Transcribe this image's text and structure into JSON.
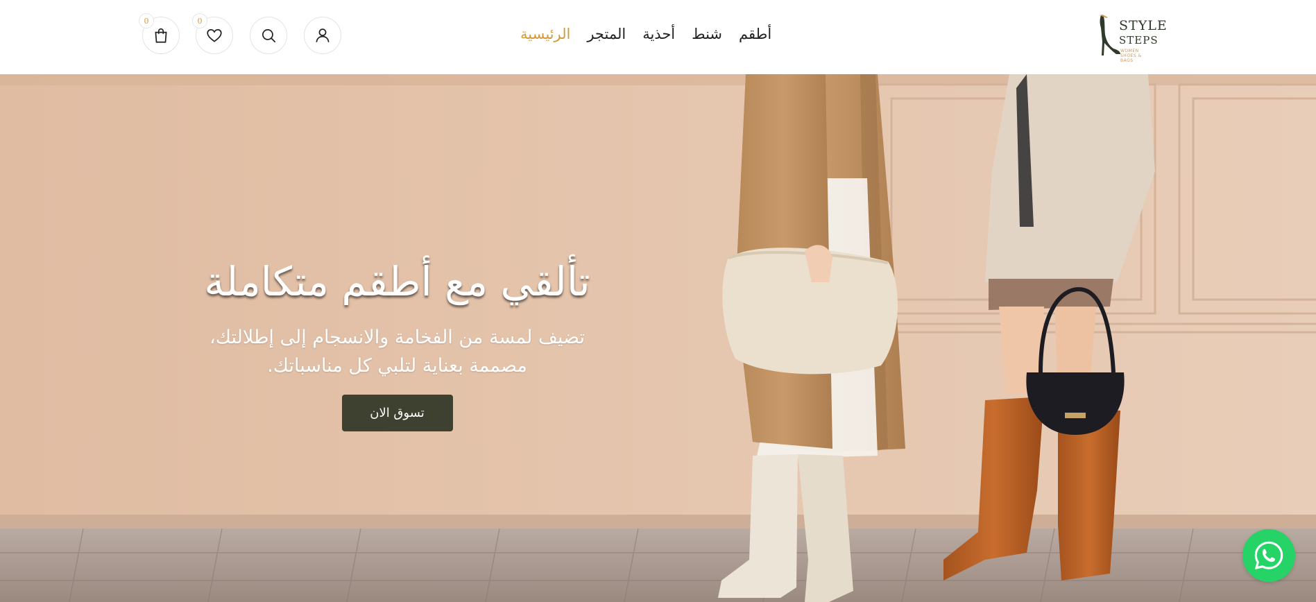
{
  "brand": {
    "line1": "STYLE",
    "line2": "STEPS",
    "tagline": "WOMEN SHOES & BAGS"
  },
  "nav": {
    "items": [
      {
        "label": "الرئيسية",
        "active": true
      },
      {
        "label": "المتجر",
        "active": false
      },
      {
        "label": "أحذية",
        "active": false
      },
      {
        "label": "شنط",
        "active": false
      },
      {
        "label": "أطقم",
        "active": false
      }
    ]
  },
  "header_icons": {
    "account": "user-icon",
    "search": "search-icon",
    "wishlist": "heart-icon",
    "wishlist_count": "0",
    "cart": "shopping-bag-icon",
    "cart_count": "0"
  },
  "hero": {
    "title": "تألقي مع أطقم متكاملة",
    "subtitle_line1": "تضيف لمسة من الفخامة والانسجام إلى إطلالتك،",
    "subtitle_line2": "مصممة بعناية لتلبي كل مناسباتك.",
    "cta_label": "تسوق الان"
  },
  "floating": {
    "whatsapp_icon": "whatsapp-icon"
  },
  "colors": {
    "accent": "#d39a3d",
    "button": "#3f4130",
    "wall": "#e3c2a8",
    "whatsapp": "#25d366"
  }
}
